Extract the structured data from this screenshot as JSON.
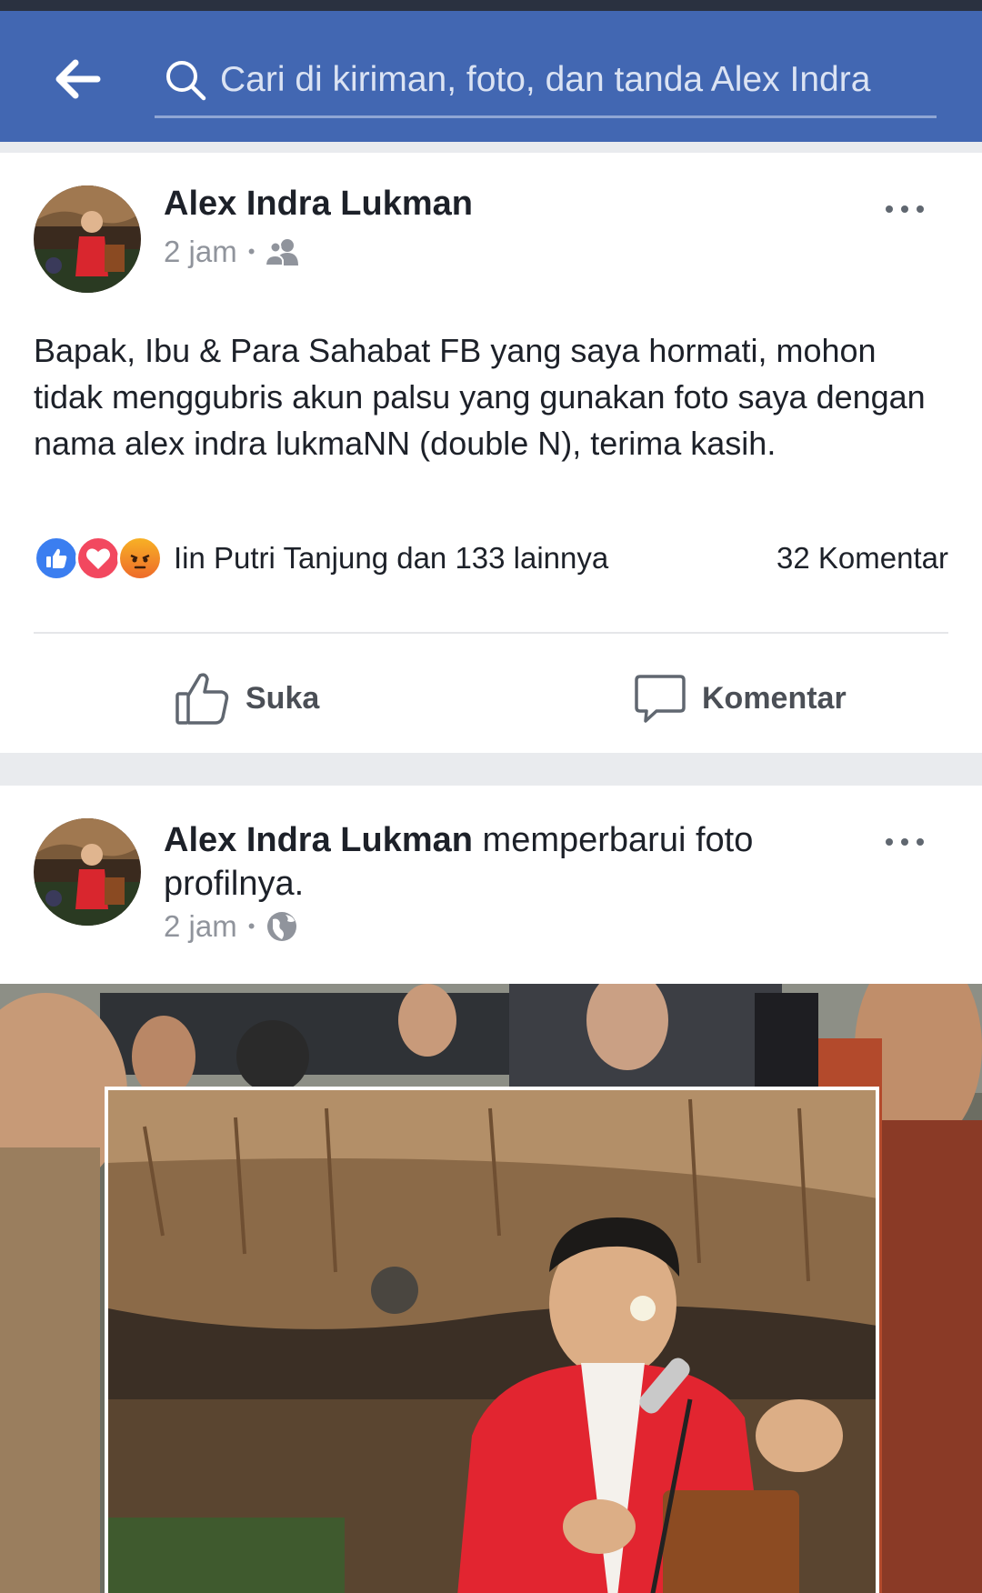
{
  "header": {
    "search_placeholder": "Cari di kiriman, foto, dan tanda Alex Indra",
    "back_icon": "arrow-left-icon",
    "search_icon": "search-icon",
    "bar_color": "#4267b2"
  },
  "post1": {
    "author": "Alex Indra Lukman",
    "time": "2 jam",
    "privacy_icon": "friends-icon",
    "text": "Bapak, Ibu & Para Sahabat FB yang saya hormati, mohon tidak menggubris akun palsu yang gunakan foto saya dengan nama alex indra lukmaNN (double N), terima kasih.",
    "reactions": {
      "icons": [
        "like-icon",
        "love-icon",
        "angry-icon"
      ],
      "summary": "Iin Putri Tanjung dan 133 lainnya",
      "comments": "32 Komentar"
    },
    "actions": {
      "like_label": "Suka",
      "comment_label": "Komentar"
    }
  },
  "post2": {
    "author": "Alex Indra Lukman",
    "action_text": " memperbarui foto profilnya.",
    "time": "2 jam",
    "privacy_icon": "globe-icon"
  }
}
